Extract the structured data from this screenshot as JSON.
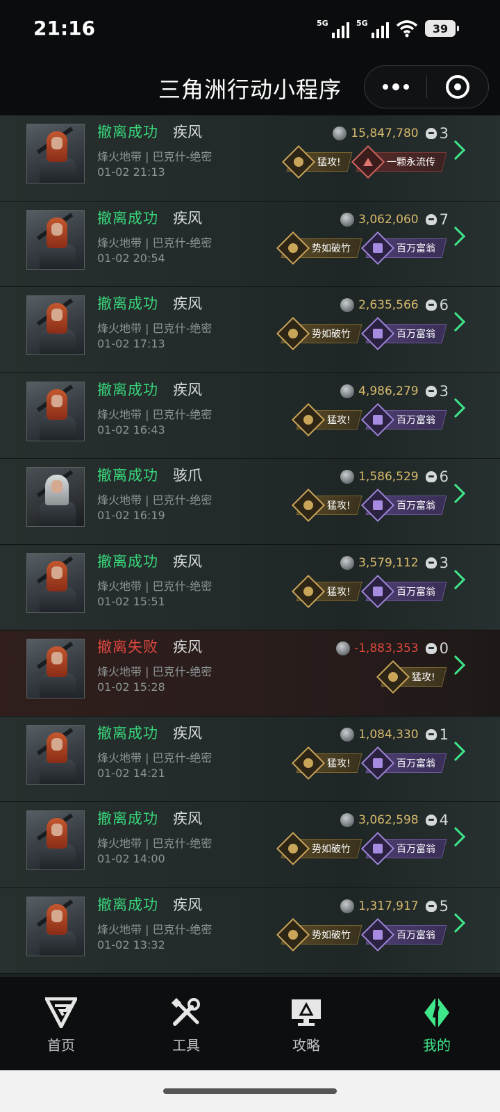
{
  "status_bar": {
    "time": "21:16",
    "signal1": "5G",
    "signal2": "5G",
    "battery": "39"
  },
  "header": {
    "title": "三角洲行动小程序"
  },
  "records": [
    {
      "status": "撤离成功",
      "result": "ok",
      "operator": "疾风",
      "map": "烽火地带 | 巴克什-绝密",
      "time": "01-02 21:13",
      "value": "15,847,780",
      "kills": "3",
      "avatar": "red-hair",
      "badges": [
        {
          "label": "猛攻!",
          "style": "gold"
        },
        {
          "label": "一颗永流传",
          "style": "red"
        }
      ]
    },
    {
      "status": "撤离成功",
      "result": "ok",
      "operator": "疾风",
      "map": "烽火地带 | 巴克什-绝密",
      "time": "01-02 20:54",
      "value": "3,062,060",
      "kills": "7",
      "avatar": "red-hair",
      "badges": [
        {
          "label": "势如破竹",
          "style": "gold"
        },
        {
          "label": "百万富翁",
          "style": "purple"
        }
      ]
    },
    {
      "status": "撤离成功",
      "result": "ok",
      "operator": "疾风",
      "map": "烽火地带 | 巴克什-绝密",
      "time": "01-02 17:13",
      "value": "2,635,566",
      "kills": "6",
      "avatar": "red-hair",
      "badges": [
        {
          "label": "势如破竹",
          "style": "gold"
        },
        {
          "label": "百万富翁",
          "style": "purple"
        }
      ]
    },
    {
      "status": "撤离成功",
      "result": "ok",
      "operator": "疾风",
      "map": "烽火地带 | 巴克什-绝密",
      "time": "01-02 16:43",
      "value": "4,986,279",
      "kills": "3",
      "avatar": "red-hair",
      "badges": [
        {
          "label": "猛攻!",
          "style": "gold"
        },
        {
          "label": "百万富翁",
          "style": "purple"
        }
      ]
    },
    {
      "status": "撤离成功",
      "result": "ok",
      "operator": "骇爪",
      "map": "烽火地带 | 巴克什-绝密",
      "time": "01-02 16:19",
      "value": "1,586,529",
      "kills": "6",
      "avatar": "white-hair",
      "badges": [
        {
          "label": "猛攻!",
          "style": "gold"
        },
        {
          "label": "百万富翁",
          "style": "purple"
        }
      ]
    },
    {
      "status": "撤离成功",
      "result": "ok",
      "operator": "疾风",
      "map": "烽火地带 | 巴克什-绝密",
      "time": "01-02 15:51",
      "value": "3,579,112",
      "kills": "3",
      "avatar": "red-hair",
      "badges": [
        {
          "label": "猛攻!",
          "style": "gold"
        },
        {
          "label": "百万富翁",
          "style": "purple"
        }
      ]
    },
    {
      "status": "撤离失败",
      "result": "fail",
      "operator": "疾风",
      "map": "烽火地带 | 巴克什-绝密",
      "time": "01-02 15:28",
      "value": "-1,883,353",
      "kills": "0",
      "avatar": "red-hair",
      "badges": [
        {
          "label": "猛攻!",
          "style": "gold"
        }
      ]
    },
    {
      "status": "撤离成功",
      "result": "ok",
      "operator": "疾风",
      "map": "烽火地带 | 巴克什-绝密",
      "time": "01-02 14:21",
      "value": "1,084,330",
      "kills": "1",
      "avatar": "red-hair",
      "badges": [
        {
          "label": "猛攻!",
          "style": "gold"
        },
        {
          "label": "百万富翁",
          "style": "purple"
        }
      ]
    },
    {
      "status": "撤离成功",
      "result": "ok",
      "operator": "疾风",
      "map": "烽火地带 | 巴克什-绝密",
      "time": "01-02 14:00",
      "value": "3,062,598",
      "kills": "4",
      "avatar": "red-hair",
      "badges": [
        {
          "label": "势如破竹",
          "style": "gold"
        },
        {
          "label": "百万富翁",
          "style": "purple"
        }
      ]
    },
    {
      "status": "撤离成功",
      "result": "ok",
      "operator": "疾风",
      "map": "烽火地带 | 巴克什-绝密",
      "time": "01-02 13:32",
      "value": "1,317,917",
      "kills": "5",
      "avatar": "red-hair",
      "badges": [
        {
          "label": "势如破竹",
          "style": "gold"
        },
        {
          "label": "百万富翁",
          "style": "purple"
        }
      ]
    }
  ],
  "tabbar": {
    "items": [
      {
        "label": "首页",
        "icon": "delta-logo-icon",
        "active": false
      },
      {
        "label": "工具",
        "icon": "tools-icon",
        "active": false
      },
      {
        "label": "攻略",
        "icon": "guide-monitor-icon",
        "active": false
      },
      {
        "label": "我的",
        "icon": "profile-logo-icon",
        "active": true
      }
    ]
  },
  "colors": {
    "success": "#38d67a",
    "fail": "#e0483e",
    "value": "#d6ba6c",
    "accent": "#3fe68a"
  }
}
